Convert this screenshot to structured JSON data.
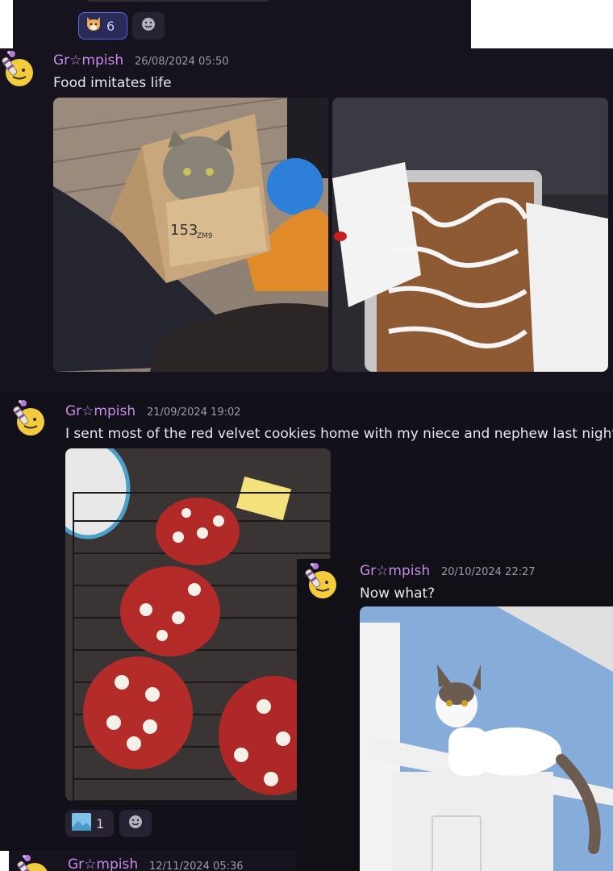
{
  "top_reaction": {
    "emoji": "fox-face-icon",
    "count": "6"
  },
  "messages": [
    {
      "username": "Gr☆mpish",
      "timestamp": "26/08/2024 05:50",
      "text": "Food imitates life",
      "images": [
        {
          "name": "cat-in-box-photo",
          "box_text": "153",
          "box_sub": "ZM9"
        },
        {
          "name": "iced-loaf-photo"
        }
      ]
    },
    {
      "username": "Gr☆mpish",
      "timestamp": "21/09/2024 19:02",
      "text": "I sent most of the red velvet cookies home with my niece and nephew last night,",
      "images": [
        {
          "name": "red-velvet-cookies-photo"
        }
      ],
      "reaction": {
        "emoji": "image-sticker-icon",
        "count": "1"
      }
    },
    {
      "username": "Gr☆mpish",
      "timestamp": "20/10/2024 22:27",
      "text": "Now what?",
      "images": [
        {
          "name": "cat-on-door-photo"
        }
      ]
    },
    {
      "username": "Gr☆mpish",
      "timestamp": "12/11/2024 05:36"
    }
  ],
  "colors": {
    "background": "#16131f",
    "username": "#c58de6",
    "timestamp": "#9f9aa8",
    "message_text": "#e9e6ee",
    "reaction_active_bg": "#2a2c58",
    "reaction_active_border": "#5865f2"
  }
}
